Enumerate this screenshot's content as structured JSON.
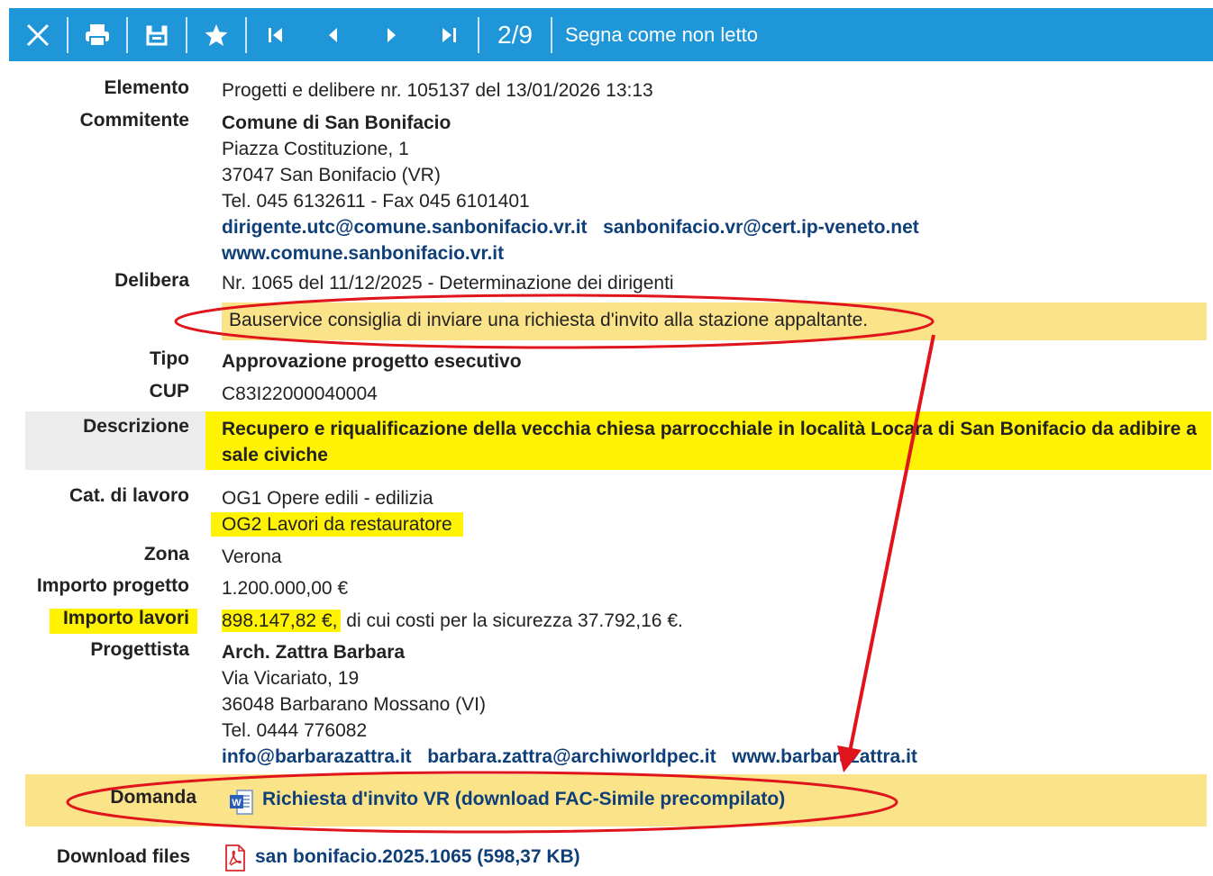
{
  "toolbar": {
    "icons": [
      "close-icon",
      "print-icon",
      "save-icon",
      "star-icon",
      "first-icon",
      "prev-icon",
      "next-icon",
      "last-icon"
    ],
    "page": "2/9",
    "mark_unread": "Segna come non letto"
  },
  "labels": {
    "elemento": "Elemento",
    "committente": "Commitente",
    "delibera": "Delibera",
    "tipo": "Tipo",
    "cup": "CUP",
    "descrizione": "Descrizione",
    "cat": "Cat. di lavoro",
    "zona": "Zona",
    "importo_progetto": "Importo progetto",
    "importo_lavori": "Importo lavori",
    "progettista": "Progettista",
    "domanda": "Domanda",
    "download": "Download files"
  },
  "elemento": "Progetti e delibere nr. 105137 del 13/01/2026 13:13",
  "committente": {
    "name": "Comune di San Bonifacio",
    "address": "Piazza Costituzione, 1",
    "city": "37047 San Bonifacio (VR)",
    "phone": "Tel. 045 6132611 - Fax 045 6101401",
    "email1": "dirigente.utc@comune.sanbonifacio.vr.it",
    "email2": "sanbonifacio.vr@cert.ip-veneto.net",
    "web": "www.comune.sanbonifacio.vr.it"
  },
  "delibera": "Nr. 1065 del 11/12/2025 - Determinazione dei dirigenti",
  "advice": "Bauservice consiglia di inviare una richiesta d'invito alla stazione appaltante.",
  "tipo": "Approvazione progetto esecutivo",
  "cup": "C83I22000040004",
  "descrizione_l1": "Recupero e riqualificazione della vecchia chiesa parrocchiale in località Locara di San Bonifacio da adibire a",
  "descrizione_l2": "sale civiche",
  "cat1": "OG1 Opere edili - edilizia",
  "cat2": "OG2 Lavori da restauratore",
  "zona": "Verona",
  "importo_progetto": "1.200.000,00 €",
  "importo_lavori_amount": "898.147,82 €,",
  "importo_lavori_rest": " di cui costi per la sicurezza 37.792,16 €.",
  "progettista": {
    "name": "Arch. Zattra Barbara",
    "address": "Via Vicariato, 19",
    "city": "36048 Barbarano Mossano (VI)",
    "phone": "Tel. 0444 776082",
    "email1": "info@barbarazattra.it",
    "email2": "barbara.zattra@archiworldpec.it",
    "web": "www.barbarazattra.it"
  },
  "domanda_link": "Richiesta d'invito VR (download FAC-Simile precompilato)",
  "download_link": "san bonifacio.2025.1065 (598,37 KB)",
  "colors": {
    "toolbar": "#1e96d8",
    "highlight": "#fff203",
    "advice_bg": "#fbe38a",
    "link": "#0f3f78",
    "annotation": "#e0151b"
  }
}
